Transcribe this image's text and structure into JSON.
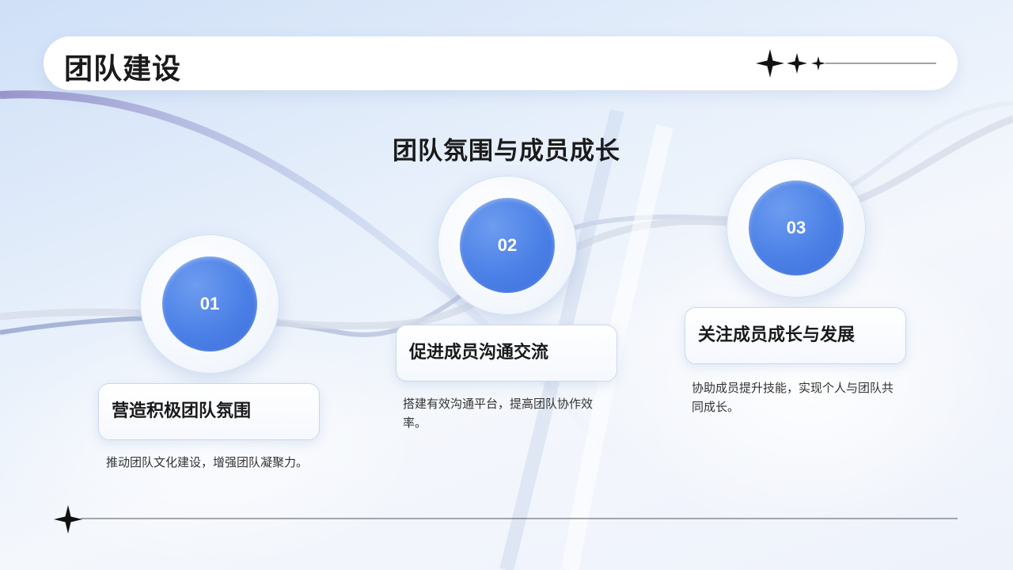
{
  "header": {
    "title": "团队建设"
  },
  "section": {
    "title": "团队氛围与成员成长"
  },
  "steps": [
    {
      "number": "01",
      "title": "营造积极团队氛围",
      "description": "推动团队文化建设，增强团队凝聚力。"
    },
    {
      "number": "02",
      "title": "促进成员沟通交流",
      "description": "搭建有效沟通平台，提高团队协作效率。"
    },
    {
      "number": "03",
      "title": "关注成员成长与发展",
      "description": "协助成员提升技能，实现个人与团队共同成长。"
    }
  ],
  "colors": {
    "accent": "#4b80e6",
    "text": "#1a1a1a",
    "background": "#e6effb"
  },
  "icons": {
    "header": "sparkle-stars-icon",
    "footer": "sparkle-star-icon"
  }
}
